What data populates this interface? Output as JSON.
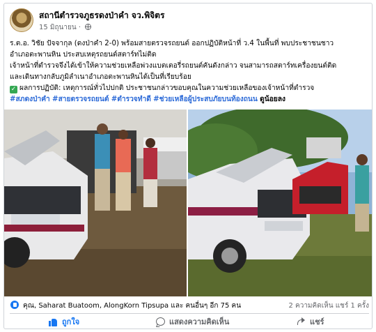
{
  "post": {
    "page_name": "สถานีตำรวจภูธรดงป่าคำ จว.พิจิตร",
    "date": "15 มิถุนายน",
    "body_lines": [
      "ร.ต.อ. วิชัย ปัจจากุล (ดงป่าคำ 2-0) พร้อมสายตรวจรถยนต์ ออกปฏิบัติหน้าที่ ว.4 ในพื้นที่ พบประชาชนชาว",
      "อำเภอตะพานหิน ประสบเหตุรถยนต์สตาร์ทไม่ติด",
      "เจ้าหน้าที่ตำรวจจึงได้เข้าให้ความช่วยเหลือพ่วงแบตเตอรี่รถยนต์คันดังกล่าว จนสามารถสตาร์ทเครื่องยนต์ติด",
      "และเดินทางกลับภูมิลำเนาอำเภอตะพานหินได้เป็นที่เรียบร้อย"
    ],
    "result_line": "ผลการปฏิบัติ: เหตุการณ์ทั่วไปปกติ ประชาชนกล่าวขอบคุณในความช่วยเหลือของเจ้าหน้าที่ตำรวจ",
    "hashtags": [
      "#สภดงป่าคำ",
      "#สายตรวจรถยนต์",
      "#ตำรวจทำดี",
      "#ช่วยเหลือผู้ประสบภัยบนท้องถนน"
    ],
    "hashtag_tail": "ดูน้อยลง"
  },
  "reactions": {
    "names": "คุณ, Saharat Buatoom, AlongKorn Tipsupa และ คนอื่นๆ อีก 75 คน",
    "stats": "2 ความคิดเห็น  แชร์ 1 ครั้ง"
  },
  "actions": {
    "like": "ถูกใจ",
    "comment": "แสดงความคิดเห็น",
    "share": "แชร์"
  },
  "colors": {
    "accent": "#1877f2",
    "hashtag": "#2d6bd8",
    "muted": "#65676b"
  }
}
